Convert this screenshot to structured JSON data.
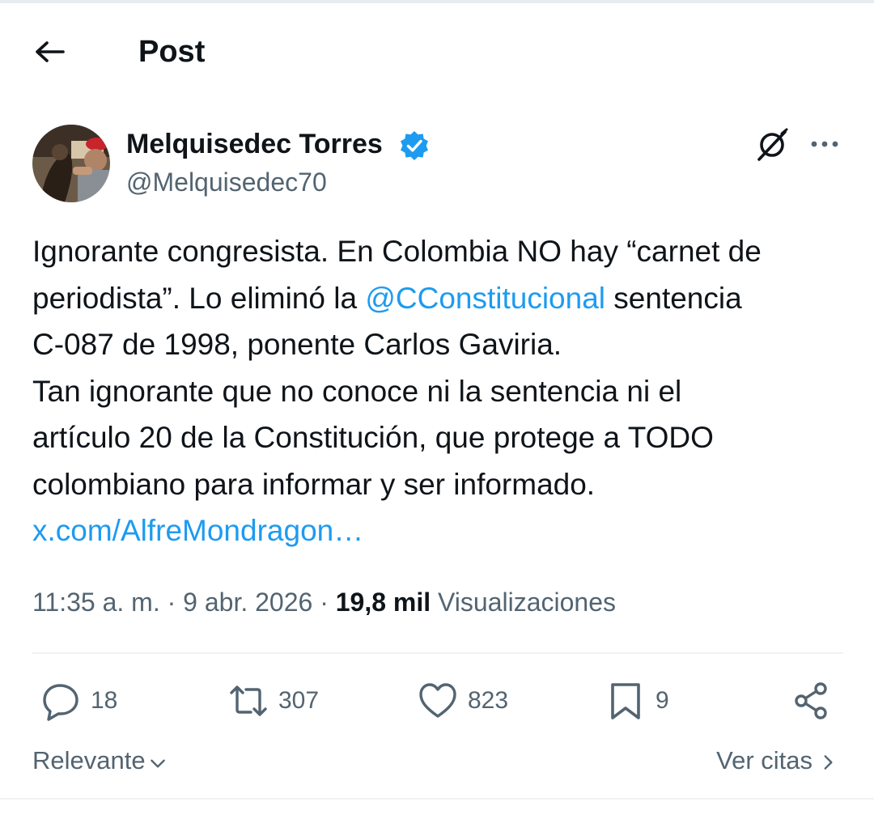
{
  "header": {
    "title": "Post"
  },
  "author": {
    "name": "Melquisedec Torres",
    "handle": "@Melquisedec70",
    "verified": true,
    "verified_color": "#1d9bf0"
  },
  "post": {
    "line1": "Ignorante congresista. En Colombia NO hay “carnet de",
    "line2_before": "periodista”. Lo eliminó la ",
    "line2_mention": "@CConstitucional",
    "line2_after": " sentencia",
    "line3": "C-087 de 1998, ponente Carlos Gaviria.",
    "line4": "Tan ignorante que no conoce ni la sentencia ni el",
    "line5": "artículo 20 de la Constitución, que protege a TODO",
    "line6": "colombiano para informar y ser informado.",
    "link": "x.com/AlfreMondragon…",
    "link_color": "#1d9bf0"
  },
  "meta": {
    "time": "11:35 a. m.",
    "sep": "·",
    "date": "9 abr. 2026",
    "views_count": "19,8 mil",
    "views_label": "Visualizaciones"
  },
  "actions": {
    "replies": "18",
    "reposts": "307",
    "likes": "823",
    "bookmarks": "9",
    "icons": [
      "reply-icon",
      "repost-icon",
      "like-icon",
      "bookmark-icon",
      "share-icon"
    ]
  },
  "footer": {
    "sort_label": "Relevante",
    "quotes_label": "Ver citas"
  }
}
